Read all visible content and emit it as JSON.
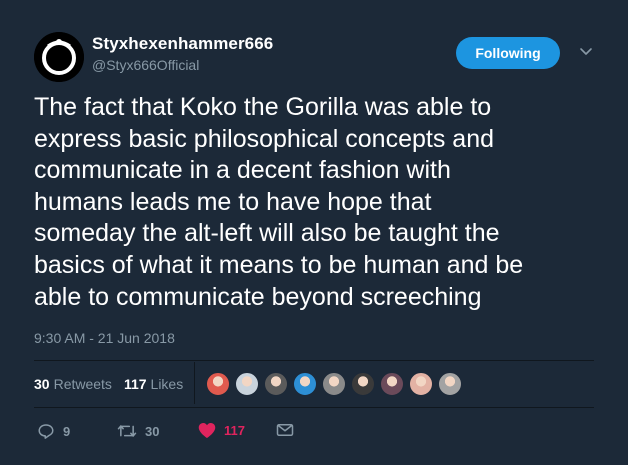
{
  "author": {
    "display_name": "Styxhexenhammer666",
    "handle": "@Styx666Official",
    "avatar_icon": "ouroboros-logo-icon"
  },
  "follow_button": {
    "label": "Following"
  },
  "tweet": {
    "lines": [
      "The fact that Koko the Gorilla was able to",
      "express basic philosophical concepts and",
      "communicate in a decent fashion with",
      "humans leads me to have hope that",
      "someday the alt-left will also be taught the",
      "basics of what it means to be human and be",
      "able to communicate beyond screeching"
    ],
    "timestamp": "9:30 AM - 21 Jun 2018"
  },
  "stats": {
    "retweets_count": "30",
    "retweets_label": "Retweets",
    "likes_count": "117",
    "likes_label": "Likes"
  },
  "likers": [
    {
      "name": "liker-1",
      "color": "#e05a4e"
    },
    {
      "name": "liker-2",
      "color": "#c9d3dc"
    },
    {
      "name": "liker-3",
      "color": "#5b5b5b"
    },
    {
      "name": "liker-4",
      "color": "#2d8fd5"
    },
    {
      "name": "liker-5",
      "color": "#8a8a8a"
    },
    {
      "name": "liker-6",
      "color": "#3a3a3a"
    },
    {
      "name": "liker-7",
      "color": "#6b4a5a"
    },
    {
      "name": "liker-8",
      "color": "#e3b2a4"
    },
    {
      "name": "liker-9",
      "color": "#a3a3a3"
    }
  ],
  "actions": {
    "reply_count": "9",
    "retweet_count": "30",
    "like_count": "117",
    "icons": [
      "reply-icon",
      "retweet-icon",
      "heart-icon",
      "message-icon"
    ]
  },
  "colors": {
    "background": "#1c2938",
    "accent": "#1d95e0",
    "muted": "#8899a6",
    "like": "#e0245e"
  }
}
